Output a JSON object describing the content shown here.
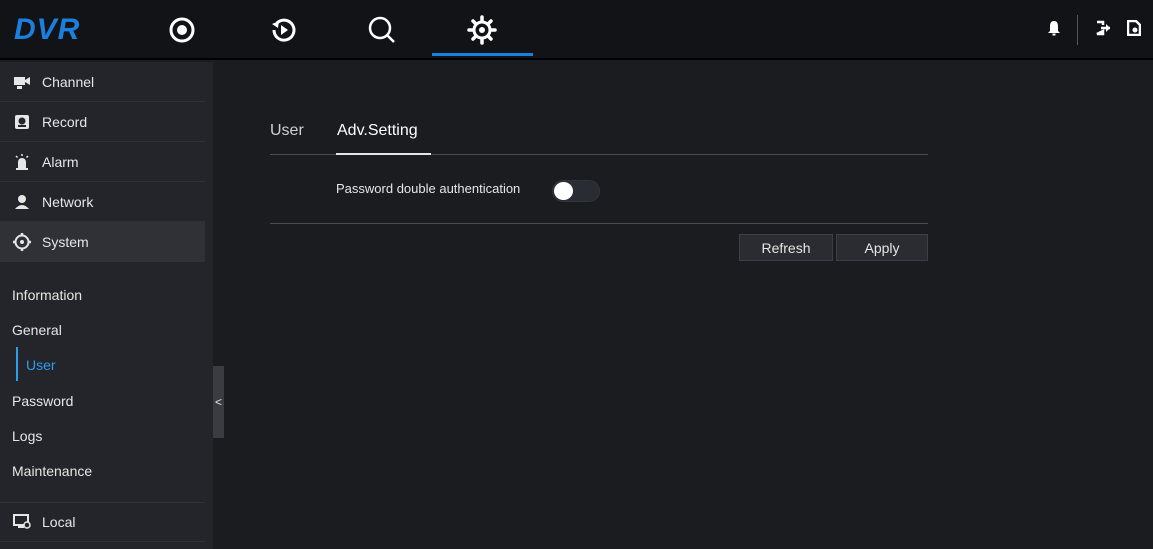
{
  "app": {
    "logo": "DVR"
  },
  "top_nav": {
    "items": [
      {
        "name": "live-view",
        "icon": "record-circle-icon"
      },
      {
        "name": "playback",
        "icon": "playback-icon"
      },
      {
        "name": "search",
        "icon": "search-icon"
      },
      {
        "name": "settings",
        "icon": "gear-icon",
        "active": true
      }
    ],
    "right_icons": [
      "bell-icon",
      "logout-icon",
      "device-icon"
    ]
  },
  "sidebar": {
    "items": [
      {
        "label": "Channel",
        "icon": "camera-icon"
      },
      {
        "label": "Record",
        "icon": "record-icon"
      },
      {
        "label": "Alarm",
        "icon": "alarm-icon"
      },
      {
        "label": "Network",
        "icon": "network-icon"
      },
      {
        "label": "System",
        "icon": "gear-icon"
      },
      {
        "label": "Local",
        "icon": "monitor-icon"
      }
    ],
    "system_subitems": [
      "Information",
      "General",
      "User",
      "Password",
      "Logs",
      "Maintenance"
    ],
    "selected_subitem": "User",
    "collapse_label": "<"
  },
  "main": {
    "tabs": [
      "User",
      "Adv.Setting"
    ],
    "active_tab": "Adv.Setting",
    "field_label": "Password double authentication",
    "toggle_on": false,
    "buttons": {
      "refresh": "Refresh",
      "apply": "Apply"
    }
  },
  "colors": {
    "accent": "#1b7fe0",
    "selected": "#2b9ef0"
  }
}
